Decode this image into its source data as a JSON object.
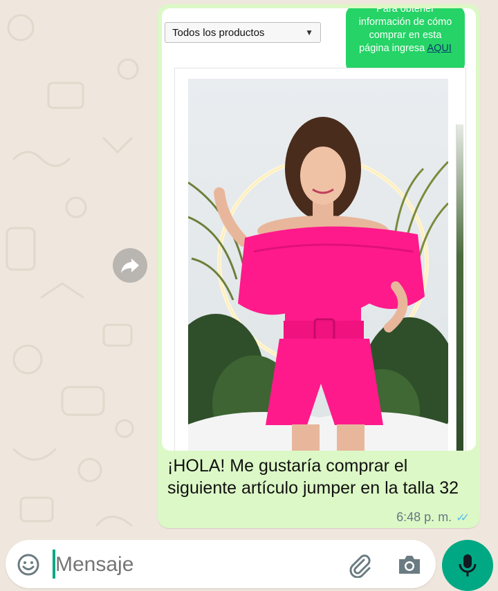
{
  "product_select": {
    "selected": "Todos los productos"
  },
  "info_box": {
    "line1": "Para obtener",
    "line2": "información de cómo",
    "line3": "comprar en esta",
    "line4_prefix": "página ingresa ",
    "link": "AQUI"
  },
  "message": {
    "text": "¡HOLA! Me gustaría comprar el siguiente artículo jumper en la talla 32",
    "time": "6:48 p. m.",
    "status_icon": "double-check-icon"
  },
  "composer": {
    "placeholder": "Mensaje"
  },
  "icons": {
    "forward": "forward-arrow-icon",
    "emoji": "emoji-icon",
    "attach": "paperclip-icon",
    "camera": "camera-icon",
    "mic": "microphone-icon"
  },
  "colors": {
    "wallpaper": "#efe7dd",
    "outgoing_bubble": "#dcf8c6",
    "brand_green": "#25d366",
    "mic_button": "#00a884",
    "read_ticks": "#53bdeb",
    "jumper_pink": "#ff1493"
  }
}
